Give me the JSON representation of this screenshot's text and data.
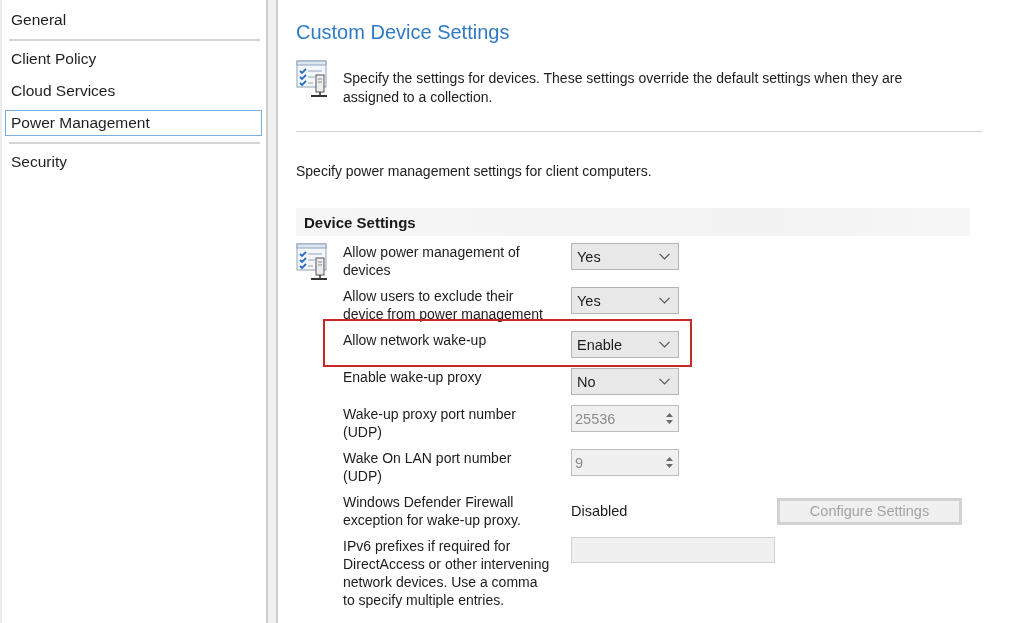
{
  "sidebar": {
    "groups": [
      {
        "items": [
          {
            "label": "General",
            "selected": false
          }
        ]
      },
      {
        "items": [
          {
            "label": "Client Policy",
            "selected": false
          },
          {
            "label": "Cloud Services",
            "selected": false
          },
          {
            "label": "Power Management",
            "selected": true
          }
        ]
      },
      {
        "items": [
          {
            "label": "Security",
            "selected": false
          }
        ]
      }
    ]
  },
  "page": {
    "title": "Custom Device Settings",
    "intro": "Specify the settings for devices. These settings override the default settings when they are assigned to a collection.",
    "description": "Specify power management settings for client computers."
  },
  "device_settings": {
    "heading": "Device Settings",
    "settings": [
      {
        "kind": "dropdown",
        "label": "Allow power management of devices",
        "value": "Yes",
        "disabled": false,
        "highlighted": false
      },
      {
        "kind": "dropdown",
        "label": "Allow users to exclude their device from power management",
        "value": "Yes",
        "disabled": false,
        "highlighted": false
      },
      {
        "kind": "dropdown",
        "label": "Allow network wake-up",
        "value": "Enable",
        "disabled": false,
        "highlighted": true
      },
      {
        "kind": "dropdown",
        "label": "Enable wake-up proxy",
        "value": "No",
        "disabled": false,
        "highlighted": false
      },
      {
        "kind": "spinner",
        "label": "Wake-up proxy port number (UDP)",
        "value": "25536",
        "disabled": true,
        "highlighted": false
      },
      {
        "kind": "spinner",
        "label": "Wake On LAN port number (UDP)",
        "value": "9",
        "disabled": true,
        "highlighted": false
      },
      {
        "kind": "status_button",
        "label": "Windows Defender Firewall exception for wake-up proxy.",
        "status": "Disabled",
        "button": "Configure Settings",
        "disabled": true,
        "highlighted": false
      },
      {
        "kind": "text_input",
        "label": "IPv6 prefixes if required for DirectAccess or other intervening network devices. Use a comma to specify multiple entries.",
        "disabled": true,
        "highlighted": false
      }
    ]
  }
}
